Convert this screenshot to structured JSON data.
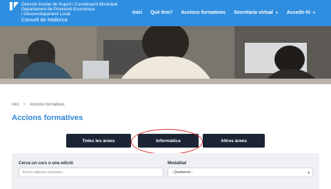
{
  "header": {
    "org_line1": "Direcció Insular de Suport i Coordinació Municipal",
    "org_line2": "Departament de Promoció Econòmica",
    "org_line3": "i Desenvolupament Local",
    "org_line4": "Consell de Mallorca",
    "nav": [
      {
        "label": "Inici"
      },
      {
        "label": "Què fem?"
      },
      {
        "label": "Accions formatives"
      },
      {
        "label": "Secretaria virtual"
      },
      {
        "label": "Accedir-hi"
      }
    ],
    "brand_color": "#2f8ee0"
  },
  "breadcrumb": {
    "home": "Inici",
    "separator": ">",
    "current": "Accions formatives"
  },
  "page_title": "Accions formatives",
  "tabs": [
    {
      "label": "Totes les àrees"
    },
    {
      "label": "Informàtica"
    },
    {
      "label": "Altres àrees"
    }
  ],
  "filters": {
    "search_label": "Cerca un curs o una edició",
    "search_placeholder": "Escriu algunes paraules...",
    "mode_label": "Modalitat",
    "mode_value": "- Qualsevol -"
  },
  "colors": {
    "title": "#2e86d6",
    "tab_bg": "#1b2536",
    "highlight": "#d42a2a"
  }
}
